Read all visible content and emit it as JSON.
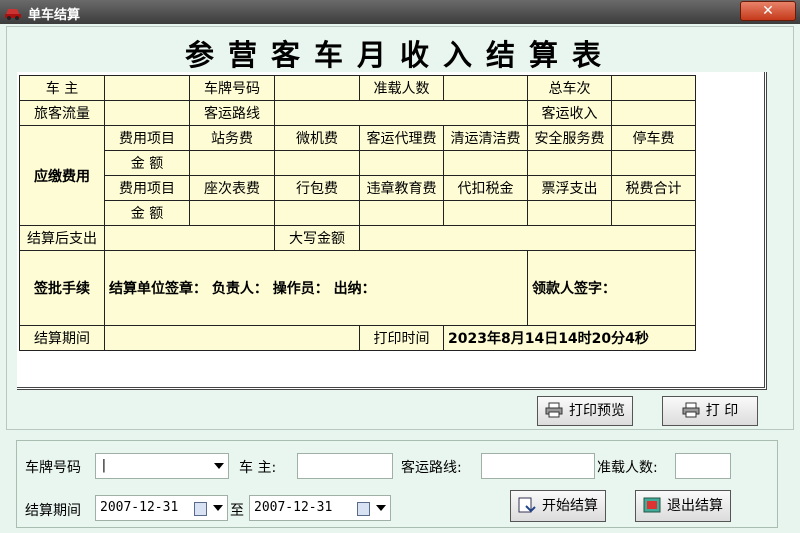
{
  "window": {
    "title": "单车结算",
    "close_label": "✕"
  },
  "report": {
    "title": "参营客车月收入结算表",
    "row1": [
      "车 主",
      "车牌号码",
      "准载人数",
      "总车次"
    ],
    "row2": [
      "旅客流量",
      "客运路线",
      "客运收入"
    ],
    "fee_label": "应缴费用",
    "fee_item_label": "费用项目",
    "amount_label": "金 额",
    "fees1": [
      "站务费",
      "微机费",
      "客运代理费",
      "清运清洁费",
      "安全服务费",
      "停车费"
    ],
    "fees2": [
      "座次表费",
      "行包费",
      "违章教育费",
      "代扣税金",
      "票浮支出",
      "税费合计"
    ],
    "after_expense": "结算后支出",
    "amount_upper": "大写金额",
    "approval_label": "签批手续",
    "approval_text": "结算单位签章：  负责人：     操作员：     出纳：",
    "payee_sign": "领款人签字：",
    "period_label": "结算期间",
    "print_time_label": "打印时间",
    "print_time_value": "2023年8月14日14时20分4秒"
  },
  "buttons": {
    "print_preview": "打印预览",
    "print": "打  印",
    "start": "开始结算",
    "exit": "退出结算"
  },
  "form": {
    "plate_label": "车牌号码",
    "plate_value": "|",
    "owner_label": "车  主:",
    "route_label": "客运路线:",
    "capacity_label": "准载人数:",
    "period_label": "结算期间",
    "to_label": "至",
    "date_from": "2007-12-31",
    "date_to": "2007-12-31"
  }
}
